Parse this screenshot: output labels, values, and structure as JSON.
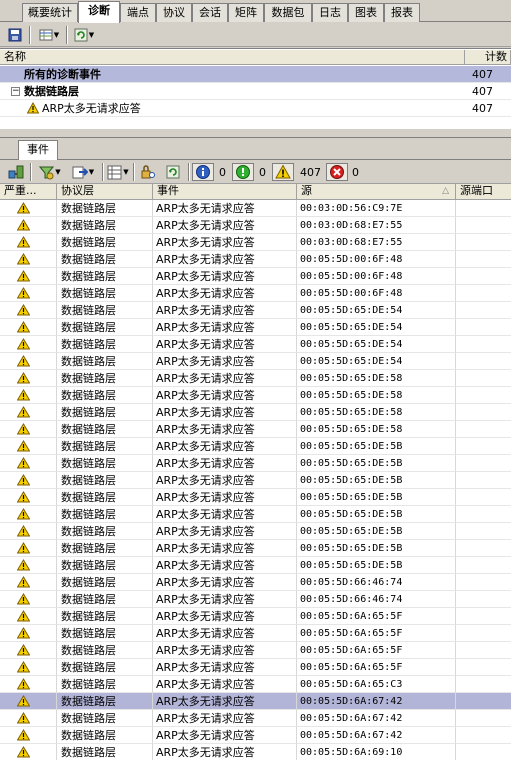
{
  "tabs": [
    "概要统计",
    "诊断",
    "端点",
    "协议",
    "会话",
    "矩阵",
    "数据包",
    "日志",
    "图表",
    "报表"
  ],
  "active_tab": "诊断",
  "diag_grid": {
    "headers": {
      "name": "名称",
      "count": "计数"
    },
    "rows": [
      {
        "label": "所有的诊断事件",
        "count": "407"
      },
      {
        "label": "数据链路层",
        "count": "407",
        "expander": "−"
      },
      {
        "label": "ARP太多无请求应答",
        "count": "407"
      }
    ]
  },
  "events_tab": "事件",
  "events_toolbar": {
    "info_count": "0",
    "ok_count": "0",
    "warn_count": "407",
    "error_count": "0"
  },
  "events_grid": {
    "headers": {
      "severity": "严重...",
      "layer": "协议层",
      "event": "事件",
      "source": "源",
      "source_port": "源端口"
    },
    "sort_indicator": "△",
    "rows": [
      {
        "layer": "数据链路层",
        "event": "ARP太多无请求应答",
        "source": "00:03:0D:56:C9:7E"
      },
      {
        "layer": "数据链路层",
        "event": "ARP太多无请求应答",
        "source": "00:03:0D:68:E7:55"
      },
      {
        "layer": "数据链路层",
        "event": "ARP太多无请求应答",
        "source": "00:03:0D:68:E7:55"
      },
      {
        "layer": "数据链路层",
        "event": "ARP太多无请求应答",
        "source": "00:05:5D:00:6F:48"
      },
      {
        "layer": "数据链路层",
        "event": "ARP太多无请求应答",
        "source": "00:05:5D:00:6F:48"
      },
      {
        "layer": "数据链路层",
        "event": "ARP太多无请求应答",
        "source": "00:05:5D:00:6F:48"
      },
      {
        "layer": "数据链路层",
        "event": "ARP太多无请求应答",
        "source": "00:05:5D:65:DE:54"
      },
      {
        "layer": "数据链路层",
        "event": "ARP太多无请求应答",
        "source": "00:05:5D:65:DE:54"
      },
      {
        "layer": "数据链路层",
        "event": "ARP太多无请求应答",
        "source": "00:05:5D:65:DE:54"
      },
      {
        "layer": "数据链路层",
        "event": "ARP太多无请求应答",
        "source": "00:05:5D:65:DE:54"
      },
      {
        "layer": "数据链路层",
        "event": "ARP太多无请求应答",
        "source": "00:05:5D:65:DE:58"
      },
      {
        "layer": "数据链路层",
        "event": "ARP太多无请求应答",
        "source": "00:05:5D:65:DE:58"
      },
      {
        "layer": "数据链路层",
        "event": "ARP太多无请求应答",
        "source": "00:05:5D:65:DE:58"
      },
      {
        "layer": "数据链路层",
        "event": "ARP太多无请求应答",
        "source": "00:05:5D:65:DE:58"
      },
      {
        "layer": "数据链路层",
        "event": "ARP太多无请求应答",
        "source": "00:05:5D:65:DE:5B"
      },
      {
        "layer": "数据链路层",
        "event": "ARP太多无请求应答",
        "source": "00:05:5D:65:DE:5B"
      },
      {
        "layer": "数据链路层",
        "event": "ARP太多无请求应答",
        "source": "00:05:5D:65:DE:5B"
      },
      {
        "layer": "数据链路层",
        "event": "ARP太多无请求应答",
        "source": "00:05:5D:65:DE:5B"
      },
      {
        "layer": "数据链路层",
        "event": "ARP太多无请求应答",
        "source": "00:05:5D:65:DE:5B"
      },
      {
        "layer": "数据链路层",
        "event": "ARP太多无请求应答",
        "source": "00:05:5D:65:DE:5B"
      },
      {
        "layer": "数据链路层",
        "event": "ARP太多无请求应答",
        "source": "00:05:5D:65:DE:5B"
      },
      {
        "layer": "数据链路层",
        "event": "ARP太多无请求应答",
        "source": "00:05:5D:65:DE:5B"
      },
      {
        "layer": "数据链路层",
        "event": "ARP太多无请求应答",
        "source": "00:05:5D:66:46:74"
      },
      {
        "layer": "数据链路层",
        "event": "ARP太多无请求应答",
        "source": "00:05:5D:66:46:74"
      },
      {
        "layer": "数据链路层",
        "event": "ARP太多无请求应答",
        "source": "00:05:5D:6A:65:5F"
      },
      {
        "layer": "数据链路层",
        "event": "ARP太多无请求应答",
        "source": "00:05:5D:6A:65:5F"
      },
      {
        "layer": "数据链路层",
        "event": "ARP太多无请求应答",
        "source": "00:05:5D:6A:65:5F"
      },
      {
        "layer": "数据链路层",
        "event": "ARP太多无请求应答",
        "source": "00:05:5D:6A:65:5F"
      },
      {
        "layer": "数据链路层",
        "event": "ARP太多无请求应答",
        "source": "00:05:5D:6A:65:C3"
      },
      {
        "layer": "数据链路层",
        "event": "ARP太多无请求应答",
        "source": "00:05:5D:6A:67:42",
        "selected": true
      },
      {
        "layer": "数据链路层",
        "event": "ARP太多无请求应答",
        "source": "00:05:5D:6A:67:42"
      },
      {
        "layer": "数据链路层",
        "event": "ARP太多无请求应答",
        "source": "00:05:5D:6A:67:42"
      },
      {
        "layer": "数据链路层",
        "event": "ARP太多无请求应答",
        "source": "00:05:5D:6A:69:10"
      }
    ]
  },
  "icons": {
    "toolbar_top": [
      "save-icon",
      "grid-view-icon",
      "refresh-icon"
    ],
    "events_toolbar": [
      "network-icon",
      "filter-icon",
      "export-icon",
      "columns-icon",
      "lock-search-icon",
      "refresh-icon",
      "info-icon",
      "ok-icon",
      "warning-icon",
      "error-icon"
    ]
  },
  "colors": {
    "selected_row": "#b2b4d8",
    "group_row": "#b4b9dc",
    "warning": "#f5d000",
    "error": "#d82020",
    "ok": "#30b030",
    "info": "#3060c0"
  }
}
